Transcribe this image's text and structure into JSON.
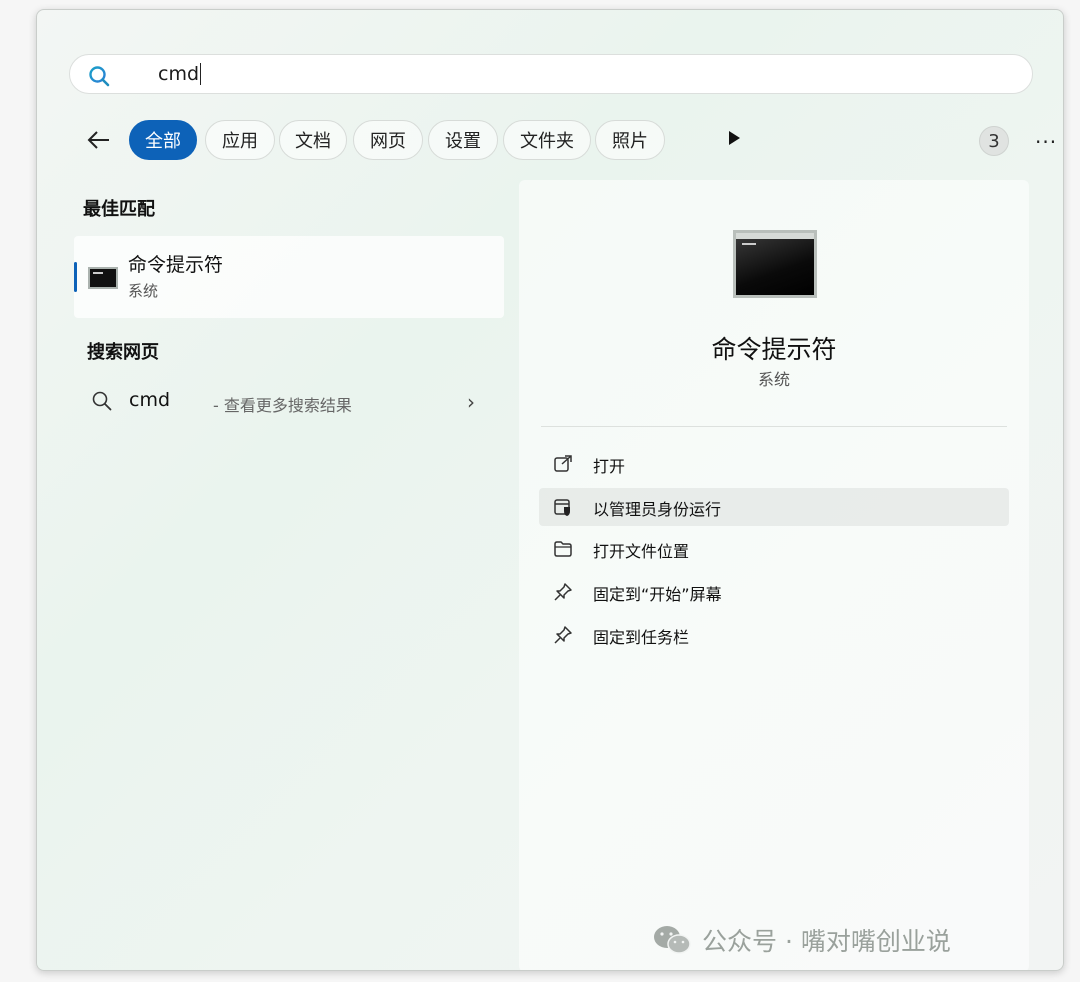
{
  "search": {
    "query": "cmd"
  },
  "filters": {
    "tabs": [
      {
        "label": "全部",
        "active": true
      },
      {
        "label": "应用"
      },
      {
        "label": "文档"
      },
      {
        "label": "网页"
      },
      {
        "label": "设置"
      },
      {
        "label": "文件夹"
      },
      {
        "label": "照片"
      }
    ],
    "badge": "3",
    "more": "···"
  },
  "left": {
    "best_match_title": "最佳匹配",
    "best_match": {
      "name": "命令提示符",
      "type": "系统"
    },
    "web_title": "搜索网页",
    "web_result": {
      "query": "cmd",
      "hint": "- 查看更多搜索结果",
      "chevron": "›"
    }
  },
  "detail": {
    "name": "命令提示符",
    "type": "系统",
    "actions": [
      {
        "label": "打开",
        "icon": "open-external-icon"
      },
      {
        "label": "以管理员身份运行",
        "icon": "admin-shield-icon"
      },
      {
        "label": "打开文件位置",
        "icon": "folder-icon"
      },
      {
        "label": "固定到“开始”屏幕",
        "icon": "pin-icon"
      },
      {
        "label": "固定到任务栏",
        "icon": "pin-icon"
      }
    ]
  },
  "watermark": {
    "text": "公众号 · 嘴对嘴创业说"
  },
  "colors": {
    "accent": "#0d62b8"
  }
}
